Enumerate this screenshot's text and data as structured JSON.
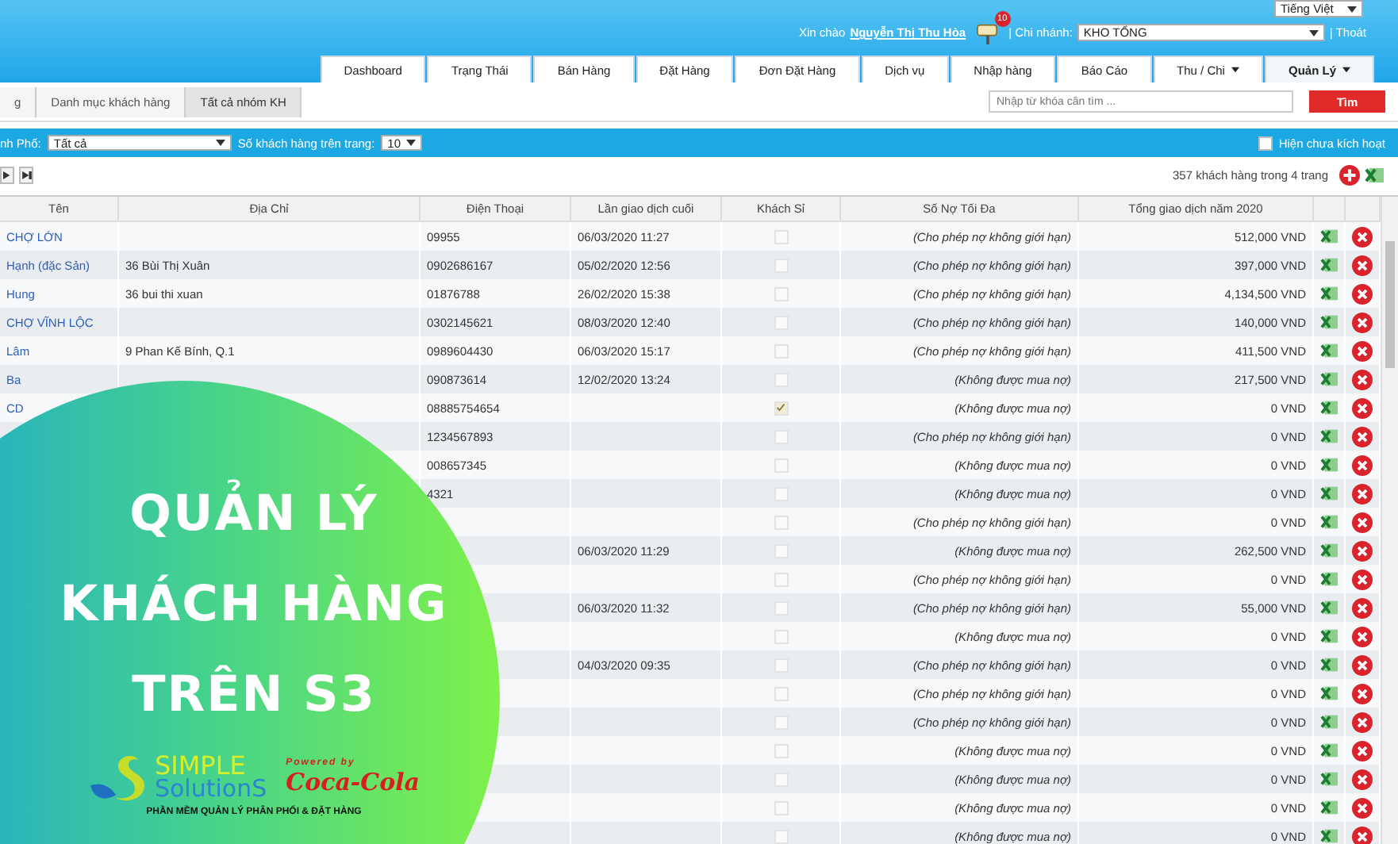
{
  "header": {
    "language": "Tiếng Việt",
    "greeting": "Xin chào",
    "user": "Nguyễn Thị Thu Hòa",
    "mail_count": "10",
    "branch_label": "| Chi nhánh:",
    "branch": "KHO TỔNG",
    "logout": "| Thoát"
  },
  "nav_tabs": [
    {
      "label": "Dashboard",
      "selected": false,
      "dropdown": false
    },
    {
      "label": "Trạng Thái",
      "selected": false,
      "dropdown": false
    },
    {
      "label": "Bán Hàng",
      "selected": false,
      "dropdown": false
    },
    {
      "label": "Đặt Hàng",
      "selected": false,
      "dropdown": false
    },
    {
      "label": "Đơn Đặt Hàng",
      "selected": false,
      "dropdown": false
    },
    {
      "label": "Dịch vụ",
      "selected": false,
      "dropdown": false
    },
    {
      "label": "Nhập hàng",
      "selected": false,
      "dropdown": false
    },
    {
      "label": "Báo Cáo",
      "selected": false,
      "dropdown": false
    },
    {
      "label": "Thu / Chi",
      "selected": false,
      "dropdown": true
    },
    {
      "label": "Quản Lý",
      "selected": true,
      "dropdown": true
    }
  ],
  "breadcrumb": [
    {
      "label": "g",
      "selected": false
    },
    {
      "label": "Danh mục khách hàng",
      "selected": false
    },
    {
      "label": "Tất cả nhóm KH",
      "selected": true
    }
  ],
  "search": {
    "placeholder": "Nhập từ khóa cần tìm ...",
    "button": "Tìm"
  },
  "filters": {
    "city_label": "nh Phố:",
    "city": "Tất cả",
    "per_page_label": "Số khách hàng trên trang:",
    "per_page": "10",
    "inactive_label": "Hiện chưa kích hoạt",
    "inactive_checked": false
  },
  "summary": "357 khách hàng trong 4 trang",
  "table": {
    "columns": [
      "Tên",
      "Địa Chỉ",
      "Điện Thoại",
      "Lần giao dịch cuối",
      "Khách Sỉ",
      "Số Nợ Tối Đa",
      "Tổng giao dịch năm 2020"
    ],
    "rows": [
      {
        "name": "CHỢ LỚN",
        "phone": "09955",
        "last": "06/03/2020 11:27",
        "wholesale": false,
        "debt": "(Cho phép nợ không giới hạn)",
        "total": "512,000 VND"
      },
      {
        "name": "Hạnh (đặc Sản)",
        "address": "36 Bùi Thị Xuân",
        "phone": "0902686167",
        "last": "05/02/2020 12:56",
        "wholesale": false,
        "debt": "(Cho phép nợ không giới hạn)",
        "total": "397,000 VND"
      },
      {
        "name": "Hung",
        "address": "36 bui thi xuan",
        "phone": "01876788",
        "last": "26/02/2020 15:38",
        "wholesale": false,
        "debt": "(Cho phép nợ không giới hạn)",
        "total": "4,134,500 VND"
      },
      {
        "name": "CHỢ VĨNH LỘC",
        "phone": "0302145621",
        "last": "08/03/2020 12:40",
        "wholesale": false,
        "debt": "(Cho phép nợ không giới hạn)",
        "total": "140,000 VND"
      },
      {
        "name": "Lâm",
        "address": "9 Phan Kế Bính, Q.1",
        "phone": "0989604430",
        "last": "06/03/2020 15:17",
        "wholesale": false,
        "debt": "(Cho phép nợ không giới hạn)",
        "total": "411,500 VND"
      },
      {
        "name": "Ba",
        "phone": "090873614",
        "last": "12/02/2020 13:24",
        "wholesale": false,
        "debt": "(Không được mua nợ)",
        "total": "217,500 VND"
      },
      {
        "name": "CD",
        "phone": "08885754654",
        "wholesale": true,
        "debt": "(Không được mua nợ)",
        "total": "0 VND"
      },
      {
        "phone": "1234567893",
        "wholesale": false,
        "debt": "(Cho phép nợ không giới hạn)",
        "total": "0 VND"
      },
      {
        "phone": "008657345",
        "wholesale": false,
        "debt": "(Không được mua nợ)",
        "total": "0 VND"
      },
      {
        "phone": "4321",
        "wholesale": false,
        "debt": "(Không được mua nợ)",
        "total": "0 VND"
      },
      {
        "wholesale": false,
        "debt": "(Cho phép nợ không giới hạn)",
        "total": "0 VND"
      },
      {
        "last": "06/03/2020 11:29",
        "wholesale": false,
        "debt": "(Không được mua nợ)",
        "total": "262,500 VND"
      },
      {
        "wholesale": false,
        "debt": "(Cho phép nợ không giới hạn)",
        "total": "0 VND"
      },
      {
        "last": "06/03/2020 11:32",
        "wholesale": false,
        "debt": "(Cho phép nợ không giới hạn)",
        "total": "55,000 VND"
      },
      {
        "wholesale": false,
        "debt": "(Không được mua nợ)",
        "total": "0 VND"
      },
      {
        "last": "04/03/2020 09:35",
        "wholesale": false,
        "debt": "(Cho phép nợ không giới hạn)",
        "total": "0 VND"
      },
      {
        "wholesale": false,
        "debt": "(Cho phép nợ không giới hạn)",
        "total": "0 VND"
      },
      {
        "wholesale": false,
        "debt": "(Cho phép nợ không giới hạn)",
        "total": "0 VND"
      },
      {
        "wholesale": false,
        "debt": "(Không được mua nợ)",
        "total": "0 VND"
      },
      {
        "wholesale": false,
        "debt": "(Không được mua nợ)",
        "total": "0 VND"
      },
      {
        "wholesale": false,
        "debt": "(Không được mua nợ)",
        "total": "0 VND"
      },
      {
        "wholesale": false,
        "debt": "(Không được mua nợ)",
        "total": "0 VND"
      }
    ]
  },
  "promo": {
    "title_lines": [
      "QUẢN LÝ",
      "KHÁCH HÀNG",
      "TRÊN S3"
    ],
    "logo_top": "SIMPLE",
    "logo_bottom": "SolutionS",
    "powered_by": "Powered by",
    "partner": "Coca-Cola",
    "tagline": "PHẦN MỀM QUẢN LÝ PHÂN PHỐI & ĐẶT HÀNG"
  }
}
